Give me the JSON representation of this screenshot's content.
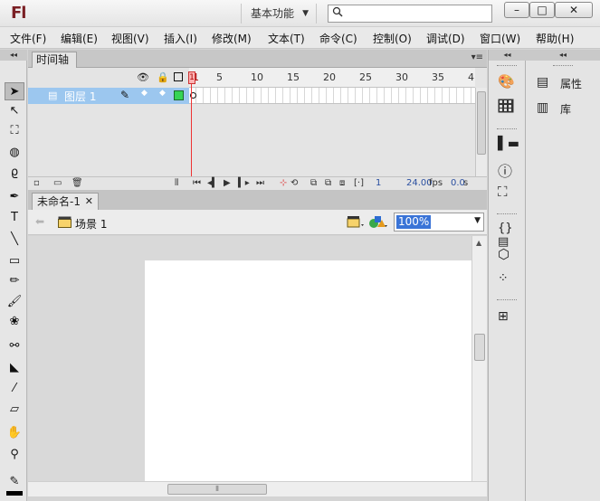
{
  "app": {
    "logo": "Fl",
    "workspace": "基本功能"
  },
  "window_buttons": {
    "minimize": "–",
    "maximize": "□",
    "close": "✕"
  },
  "menu": [
    "文件(F)",
    "编辑(E)",
    "视图(V)",
    "插入(I)",
    "修改(M)",
    "文本(T)",
    "命令(C)",
    "控制(O)",
    "调试(D)",
    "窗口(W)",
    "帮助(H)"
  ],
  "timeline": {
    "tab": "时间轴",
    "ruler": [
      "1",
      "5",
      "10",
      "15",
      "20",
      "25",
      "30",
      "35",
      "4"
    ],
    "layer_name": "图层 1",
    "current_frame": "1",
    "frame_rate": "24.00",
    "fps_label": "fps",
    "elapsed": "0.0",
    "elapsed_unit": "s"
  },
  "document": {
    "tab": "未命名-1",
    "scene": "场景 1",
    "zoom": "100%"
  },
  "panels": {
    "properties": "属性",
    "library": "库"
  },
  "colors": {
    "accent": "#3a74d7",
    "layer_selected": "#9cc7ef",
    "playhead": "#e33333",
    "logo": "#7a1f24"
  }
}
